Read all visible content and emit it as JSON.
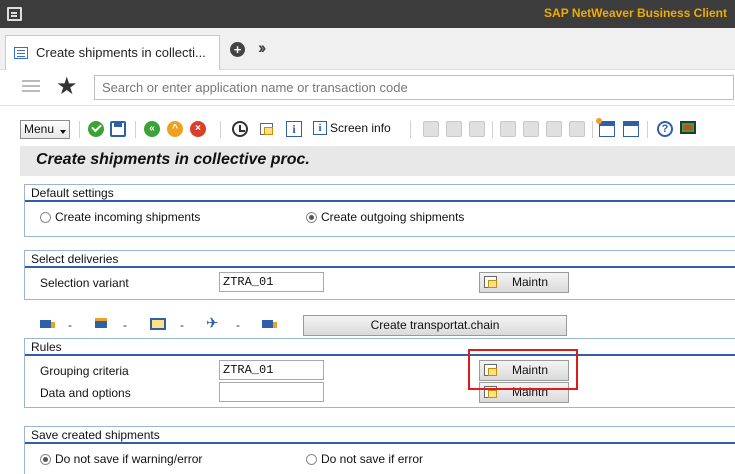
{
  "window": {
    "app_title": "SAP NetWeaver Business Client"
  },
  "tabs": {
    "active_label": "Create shipments in collecti..."
  },
  "command_bar": {
    "placeholder": "Search or enter application name or transaction code"
  },
  "toolbar": {
    "menu_label": "Menu",
    "screen_info_label": "Screen info"
  },
  "page": {
    "title": "Create shipments in collective proc."
  },
  "default_settings": {
    "title": "Default settings",
    "incoming_label": "Create incoming shipments",
    "outgoing_label": "Create outgoing shipments",
    "selected": "outgoing"
  },
  "select_deliveries": {
    "title": "Select deliveries",
    "selection_variant_label": "Selection variant",
    "selection_variant_value": "ZTRA_01",
    "maintain_label": "Maintn"
  },
  "transport_chain": {
    "button_label": "Create transportat.chain",
    "icons": [
      "truck-icon",
      "container-icon",
      "rail-icon",
      "plane-icon",
      "truck-icon"
    ],
    "dash": "-"
  },
  "rules": {
    "title": "Rules",
    "grouping_criteria_label": "Grouping criteria",
    "grouping_criteria_value": "ZTRA_01",
    "data_options_label": "Data and options",
    "data_options_value": "",
    "maintain_label_1": "Maintn",
    "maintain_label_2": "Maintn"
  },
  "save_shipments": {
    "title": "Save created shipments",
    "option_warning_label": "Do not save if warning/error",
    "option_error_label": "Do not save if error",
    "selected": "warning"
  },
  "colors": {
    "titlebar_bg": "#3c3c3c",
    "brand": "#f0ab00",
    "group_line": "#2f5fa8",
    "highlight": "#e01a1a"
  }
}
